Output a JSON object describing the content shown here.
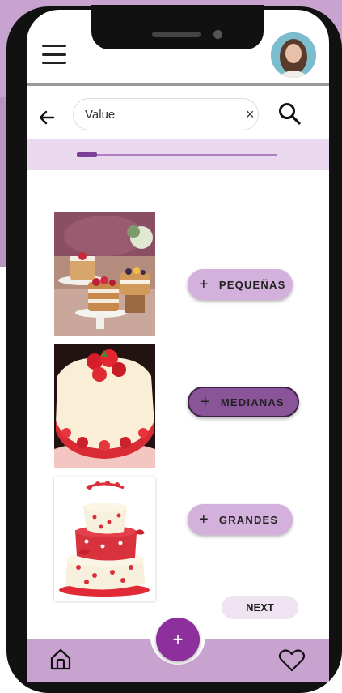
{
  "header": {
    "menu_icon": "menu-icon",
    "avatar_icon": "avatar"
  },
  "search": {
    "value": "Value",
    "clear_glyph": "×",
    "back_icon": "arrow-left-icon",
    "search_icon": "search-icon"
  },
  "progress": {
    "fraction": 0.1
  },
  "categories": [
    {
      "label": "PEQUEÑAS",
      "plus": "+"
    },
    {
      "label": "MEDIANAS",
      "plus": "+"
    },
    {
      "label": "GRANDES",
      "plus": "+"
    }
  ],
  "next_label": "NEXT",
  "bottom_nav": {
    "fab_label": "+",
    "home_icon": "home-icon",
    "heart_icon": "heart-icon"
  },
  "colors": {
    "accent": "#8e2f9e",
    "light_purple": "#c8a3cf",
    "chip": "#d4b0dc",
    "selected_chip": "#8a5499"
  }
}
